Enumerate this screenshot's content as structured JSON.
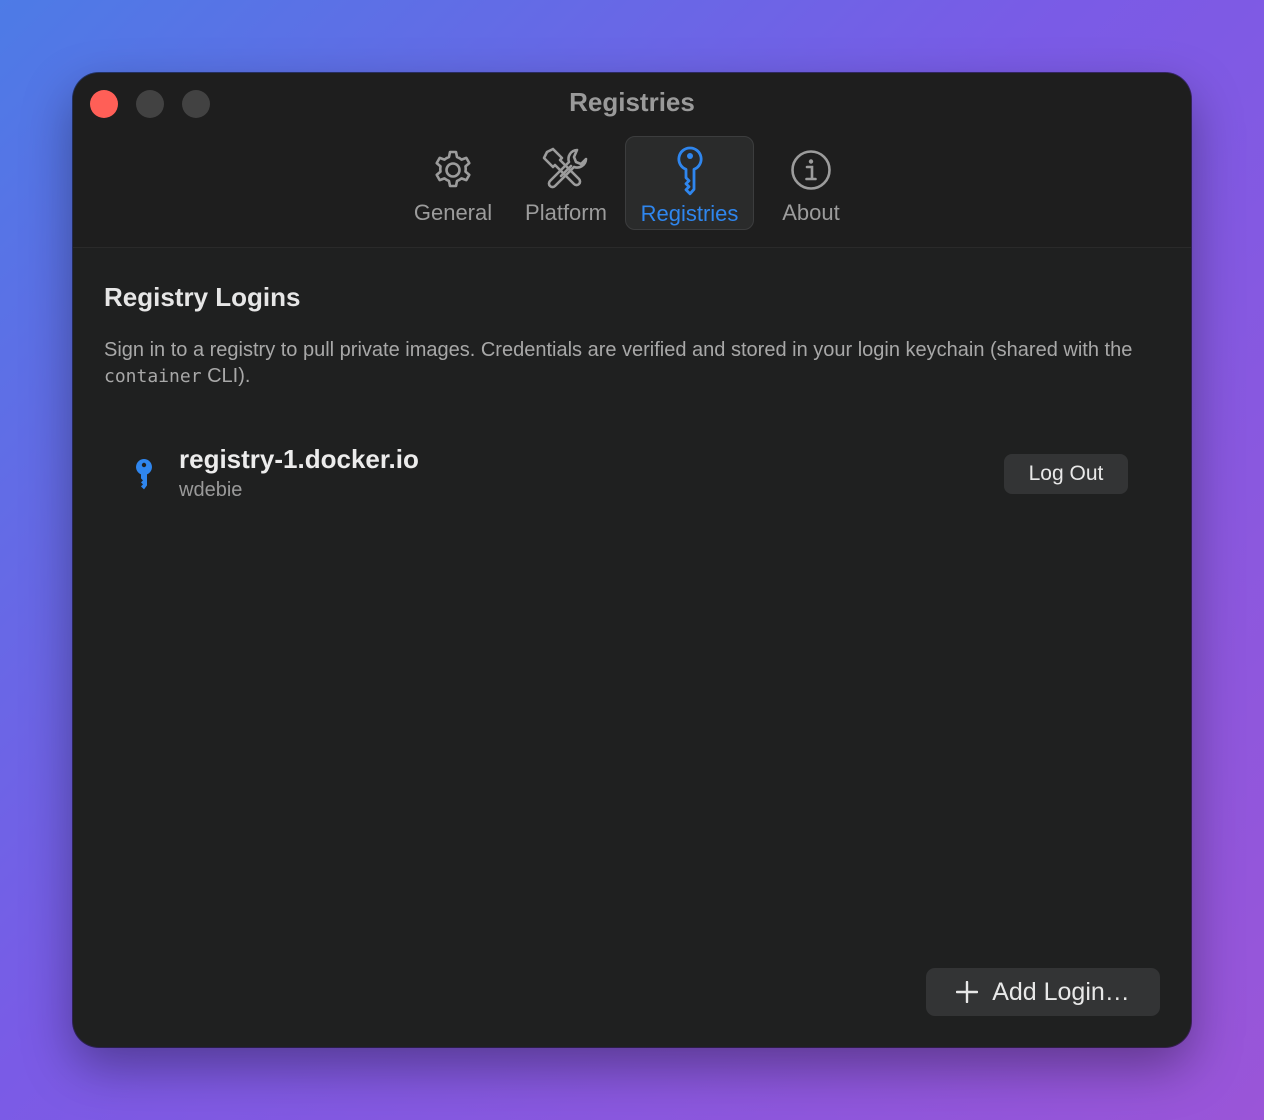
{
  "window": {
    "title": "Registries"
  },
  "tabs": [
    {
      "label": "General",
      "icon": "gear-icon"
    },
    {
      "label": "Platform",
      "icon": "tools-icon"
    },
    {
      "label": "Registries",
      "icon": "key-icon",
      "active": true
    },
    {
      "label": "About",
      "icon": "info-icon"
    }
  ],
  "section": {
    "heading": "Registry Logins",
    "desc_part1": "Sign in to a registry to pull private images. Credentials are verified and stored in your login keychain (shared with the ",
    "desc_code": "container",
    "desc_part2": " CLI)."
  },
  "logins": [
    {
      "host": "registry-1.docker.io",
      "user": "wdebie",
      "action": "Log Out"
    }
  ],
  "footer": {
    "add_label": "Add Login…"
  },
  "colors": {
    "accent": "#2f86ee",
    "close": "#ff5f57",
    "window_bg": "#1f2020"
  }
}
